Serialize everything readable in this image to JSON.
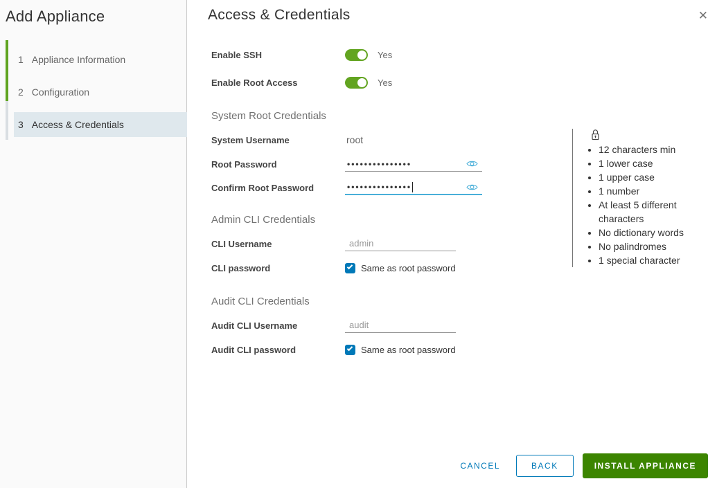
{
  "window": {
    "close_icon": "✕"
  },
  "sidebar": {
    "title": "Add Appliance",
    "steps": [
      {
        "number": "1",
        "label": "Appliance Information",
        "state": "completed"
      },
      {
        "number": "2",
        "label": "Configuration",
        "state": "completed"
      },
      {
        "number": "3",
        "label": "Access & Credentials",
        "state": "current"
      }
    ]
  },
  "main": {
    "title": "Access & Credentials",
    "enable_ssh": {
      "label": "Enable SSH",
      "value": "Yes",
      "on": true
    },
    "enable_root_access": {
      "label": "Enable Root Access",
      "value": "Yes",
      "on": true
    },
    "system_root_credentials": {
      "heading": "System Root Credentials",
      "system_username": {
        "label": "System Username",
        "value": "root"
      },
      "root_password": {
        "label": "Root Password",
        "masked_value": "•••••••••••••••"
      },
      "confirm_root_password": {
        "label": "Confirm Root Password",
        "masked_value": "•••••••••••••••"
      }
    },
    "admin_cli_credentials": {
      "heading": "Admin CLI Credentials",
      "cli_username": {
        "label": "CLI Username",
        "value": "admin"
      },
      "cli_password": {
        "label": "CLI password",
        "checkbox_label": "Same as root password",
        "checked": true
      }
    },
    "audit_cli_credentials": {
      "heading": "Audit CLI Credentials",
      "audit_cli_username": {
        "label": "Audit CLI Username",
        "value": "audit"
      },
      "audit_cli_password": {
        "label": "Audit CLI password",
        "checkbox_label": "Same as root password",
        "checked": true
      }
    },
    "password_requirements": {
      "items": [
        "12 characters min",
        "1 lower case",
        "1 upper case",
        "1 number",
        "At least 5 different characters",
        "No dictionary words",
        "No palindromes",
        "1 special character"
      ]
    },
    "footer": {
      "cancel": "CANCEL",
      "back": "BACK",
      "install": "INSTALL APPLIANCE"
    }
  },
  "colors": {
    "toggle_on_green": "#62a420",
    "install_button_green": "#3c8500",
    "action_blue": "#0079b8",
    "eye_icon_blue": "#49afd9",
    "focused_underline_blue": "#49afd9",
    "step_highlight": "#dfe8ed",
    "completed_step_bar": "#60a420",
    "current_step_bar": "#d9dee2"
  }
}
